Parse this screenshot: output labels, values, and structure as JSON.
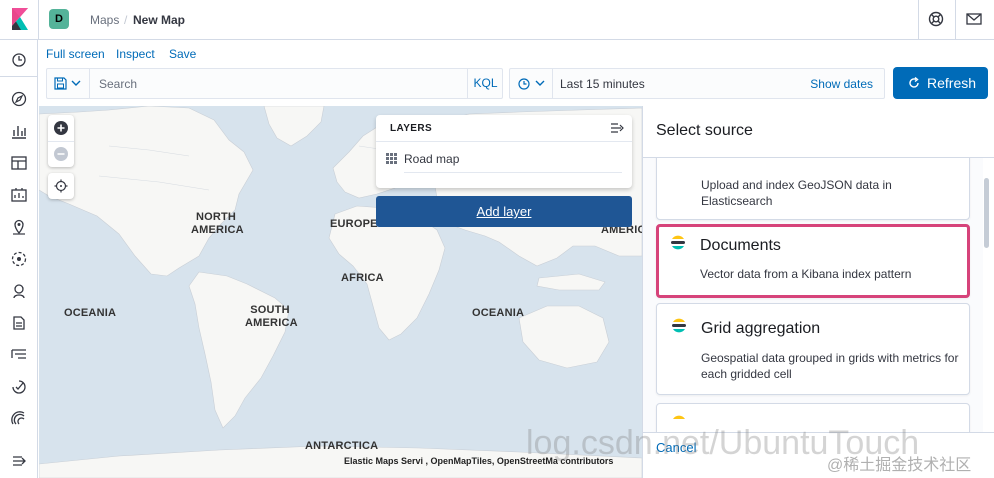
{
  "header": {
    "space_initial": "D",
    "breadcrumbs": [
      "Maps",
      "New Map"
    ],
    "breadcrumb_divider": "/"
  },
  "menu": {
    "items": [
      "Full screen",
      "Inspect",
      "Save"
    ]
  },
  "query": {
    "search_placeholder": "Search",
    "language": "KQL"
  },
  "time": {
    "range": "Last 15 minutes",
    "show_dates": "Show dates",
    "refresh_label": "Refresh"
  },
  "map": {
    "labels": [
      "NORTH AMERICA",
      "EUROPE",
      "AFRICA",
      "SOUTH AMERICA",
      "OCEANIA",
      "OCEANIA",
      "ANTARCTICA",
      "AMERIC"
    ],
    "attribution": "Elastic Maps Servi , OpenMapTiles, OpenStreetMa contributors",
    "colors": {
      "water": "#d7e3ed",
      "land": "#f7f7f5"
    }
  },
  "layers": {
    "title": "LAYERS",
    "items": [
      {
        "label": "Road map"
      }
    ],
    "add_label": "Add layer"
  },
  "source_panel": {
    "title": "Select source",
    "cards": [
      {
        "title": "",
        "description": "Upload and index GeoJSON data in Elasticsearch"
      },
      {
        "title": "Documents",
        "description": "Vector data from a Kibana index pattern"
      },
      {
        "title": "Grid aggregation",
        "description": "Geospatial data grouped in grids with metrics for each gridded cell"
      }
    ],
    "cancel_label": "Cancel"
  },
  "watermark": {
    "text": "log.csdn.net/UbuntuTouch",
    "site": "@稀土掘金技术社区"
  },
  "accent_colors": {
    "primary": "#006bb8",
    "highlight_border": "#d6437a",
    "add_layer": "#1f5695"
  }
}
